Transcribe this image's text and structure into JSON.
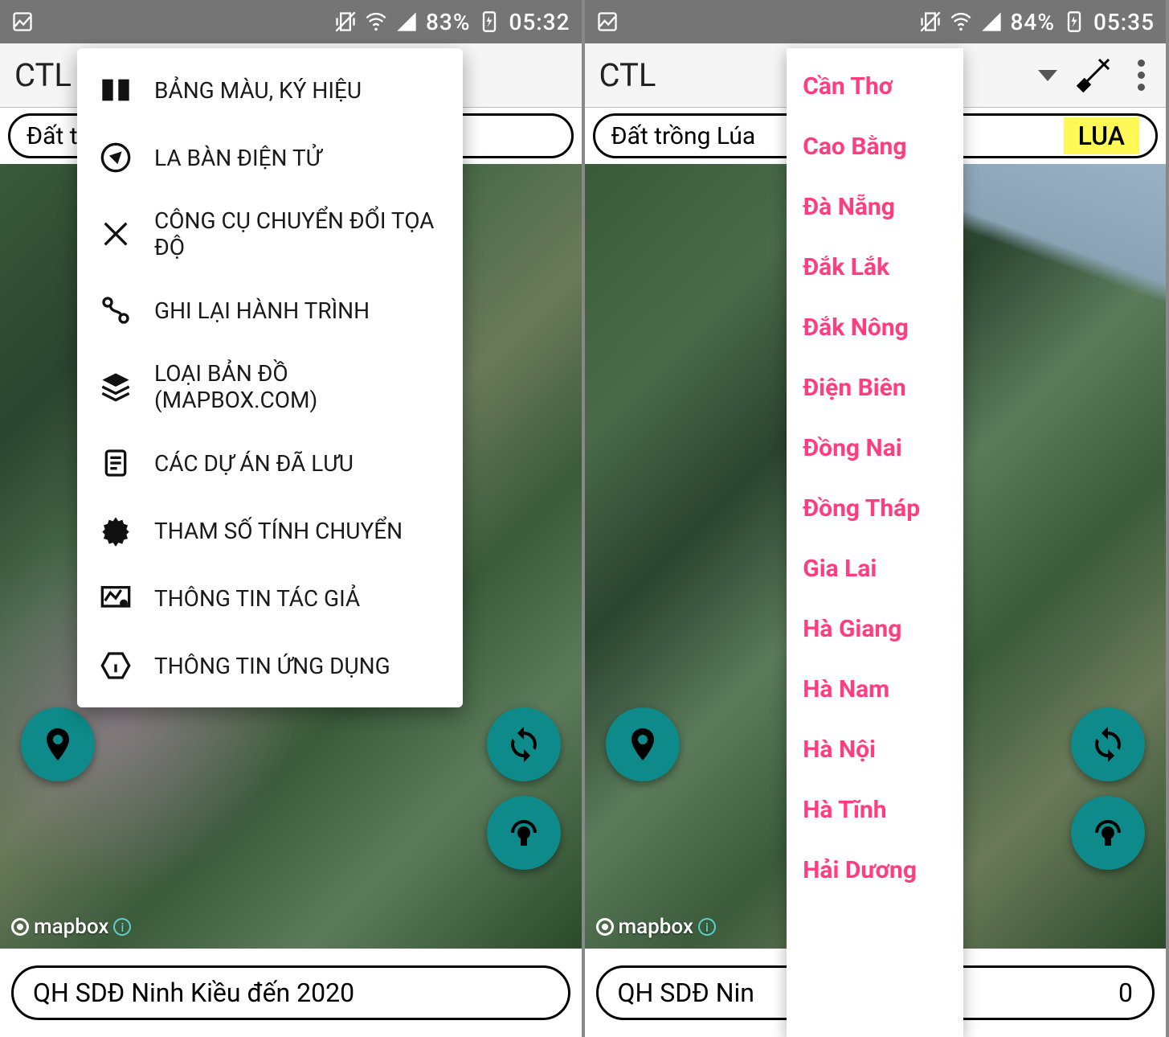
{
  "left": {
    "status": {
      "battery": "83%",
      "time": "05:32"
    },
    "appbar": {
      "title": "CTL"
    },
    "chip": {
      "label": "Đất trồ"
    },
    "menu": {
      "items": [
        {
          "label": "BẢNG MÀU, KÝ HIỆU"
        },
        {
          "label": "LA BÀN ĐIỆN TỬ"
        },
        {
          "label": "CÔNG CỤ CHUYỂN ĐỔI TỌA ĐỘ"
        },
        {
          "label": "GHI LẠI HÀNH TRÌNH"
        },
        {
          "label": "LOẠI BẢN ĐỒ (MAPBOX.COM)"
        },
        {
          "label": "CÁC DỰ ÁN ĐÃ LƯU"
        },
        {
          "label": "THAM SỐ TÍNH CHUYỂN"
        },
        {
          "label": "THÔNG TIN TÁC GIẢ"
        },
        {
          "label": "THÔNG TIN ỨNG DỤNG"
        }
      ]
    },
    "attribution": "mapbox",
    "bottom": {
      "label": "QH SDĐ Ninh Kiều đến 2020"
    }
  },
  "right": {
    "status": {
      "battery": "84%",
      "time": "05:35"
    },
    "appbar": {
      "title": "CTL"
    },
    "chip": {
      "label": "Đất trồng Lúa",
      "code": "LUA"
    },
    "dropdown": {
      "items": [
        "Cần Thơ",
        "Cao Bằng",
        "Đà Nẵng",
        "Đắk Lắk",
        "Đắk Nông",
        "Điện Biên",
        "Đồng Nai",
        "Đồng Tháp",
        "Gia Lai",
        "Hà Giang",
        "Hà Nam",
        "Hà Nội",
        "Hà Tĩnh",
        "Hải Dương"
      ]
    },
    "attribution": "mapbox",
    "bottom": {
      "label_left": "QH SDĐ Nin",
      "label_right": "0"
    }
  }
}
